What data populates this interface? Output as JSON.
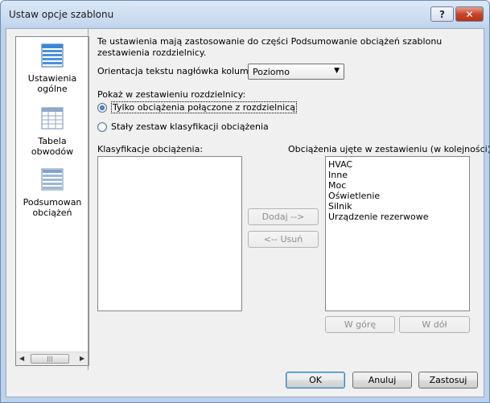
{
  "window": {
    "title": "Ustaw opcje szablonu"
  },
  "titlebar": {
    "help_label": "?",
    "close_label": "✕"
  },
  "sidebar": {
    "items": [
      {
        "label_line1": "Ustawienia",
        "label_line2": "ogólne",
        "icon": "settings-grid-icon"
      },
      {
        "label_line1": "Tabela",
        "label_line2": "obwodów",
        "icon": "table-icon"
      },
      {
        "label_line1": "Podsumowan",
        "label_line2": "obciążeń",
        "icon": "summary-grid-icon"
      }
    ],
    "scroll_left": "◀",
    "scroll_right": "▶",
    "scroll_thumb": "|||"
  },
  "panel": {
    "description": "Te ustawienia mają zastosowanie do części Podsumowanie obciążeń szablonu zestawienia rozdzielnicy.",
    "orientation_label": "Orientacja tekstu nagłówka kolumny:",
    "orientation_value": "Poziomo",
    "show_label": "Pokaż w zestawieniu rozdzielnicy:",
    "radio_connected": "Tylko obciążenia połączone z rozdzielnicą",
    "radio_fixed": "Stały zestaw klasyfikacji obciążenia",
    "classifications_label": "Klasyfikacje obciążenia:",
    "included_label": "Obciążenia ujęte w zestawieniu (w kolejności):",
    "included_items": [
      "HVAC",
      "Inne",
      "Moc",
      "Oświetlenie",
      "Silnik",
      "Urządzenie rezerwowe"
    ],
    "add_button": "Dodaj -->",
    "remove_button": "<-- Usuń",
    "up_button": "W górę",
    "down_button": "W dół"
  },
  "footer": {
    "ok": "OK",
    "cancel": "Anuluj",
    "apply": "Zastosuj"
  }
}
